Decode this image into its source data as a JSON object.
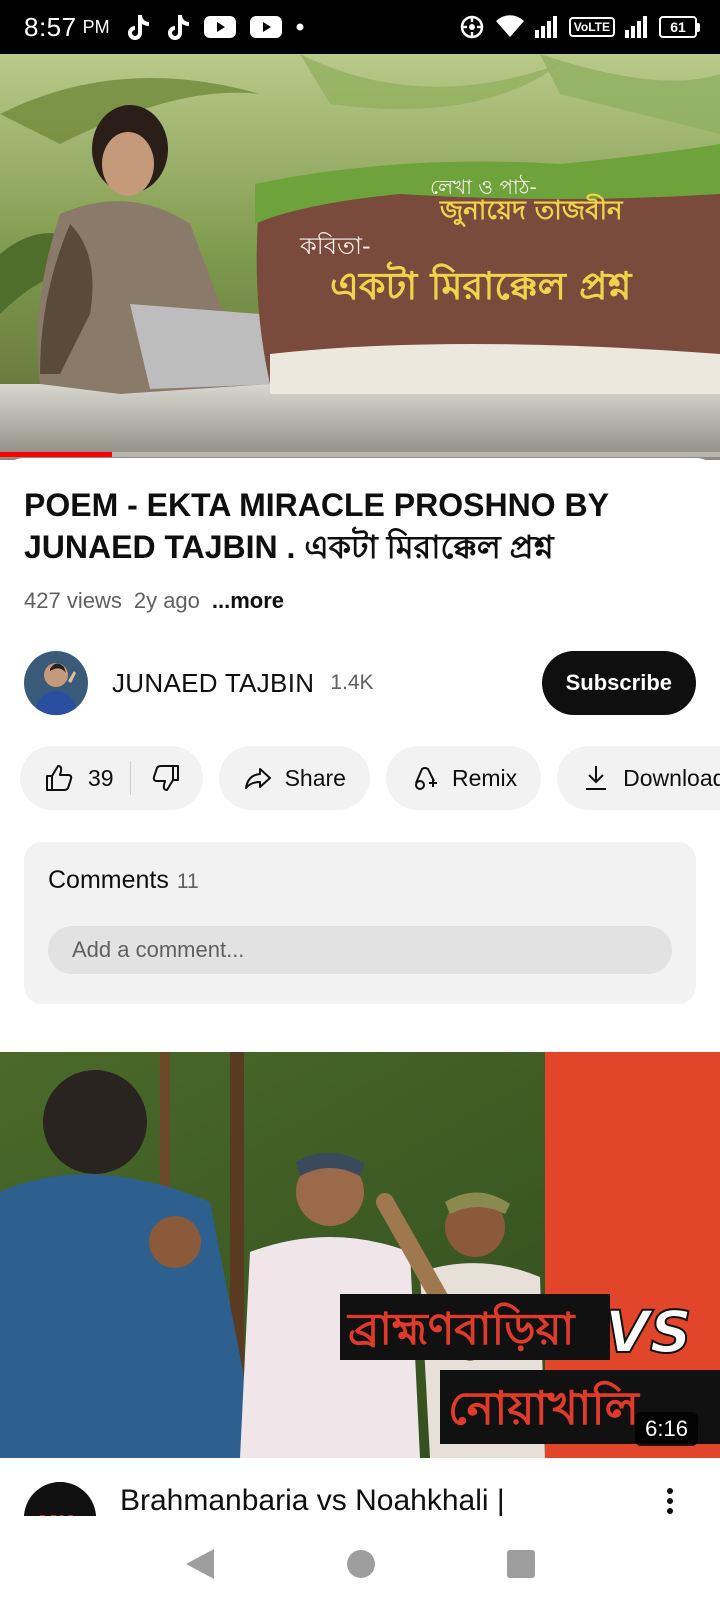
{
  "status_bar": {
    "time": "8:57",
    "ampm": "PM",
    "volte": "VoLTE",
    "battery": "61",
    "icons": [
      "tiktok-icon",
      "tiktok-icon",
      "youtube-icon",
      "youtube-icon",
      "dot-icon",
      "hotspot-icon",
      "wifi-icon",
      "signal-icon",
      "signal-icon"
    ]
  },
  "player": {
    "thumbnail_text": {
      "line1": "লেখা ও পাঠ-",
      "line2": "জুনায়েদ তাজবীন",
      "line3": "কবিতা-",
      "line4": "একটা মিরাক্কেল প্রশ্ন"
    },
    "progress_fraction": 0.155
  },
  "video": {
    "title": "POEM - EKTA MIRACLE PROSHNO BY JUNAED TAJBIN . একটা মিরাক্কেল প্রশ্ন",
    "views": "427 views",
    "age": "2y ago",
    "more_label": "...more"
  },
  "channel": {
    "name": "JUNAED TAJBIN",
    "subscribers": "1.4K",
    "subscribe_label": "Subscribe"
  },
  "actions": {
    "like_count": "39",
    "share_label": "Share",
    "remix_label": "Remix",
    "download_label": "Download"
  },
  "comments": {
    "heading": "Comments",
    "count": "11",
    "placeholder": "Add a comment..."
  },
  "next_video": {
    "thumbnail_text_top": "ব্রাহ্মণবাড়িয়া",
    "thumbnail_text_vs": "VS",
    "thumbnail_text_bottom": "নোয়াখালি",
    "duration": "6:16",
    "title": "Brahmanbaria vs Noahkhali |",
    "avatar_text": "MK"
  },
  "colors": {
    "accent": "#ff0000",
    "subscribe_bg": "#0f0f0f",
    "pill_bg": "#f2f2f2",
    "secondary_text": "#606060"
  }
}
